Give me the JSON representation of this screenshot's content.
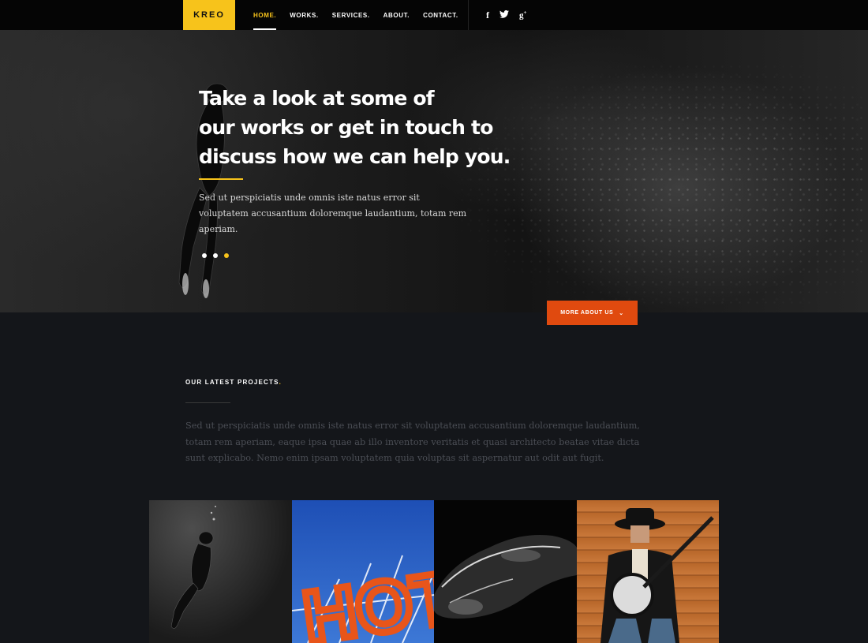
{
  "header": {
    "logo": "KREO",
    "nav": [
      {
        "label": "HOME.",
        "active": true
      },
      {
        "label": "WORKS.",
        "active": false
      },
      {
        "label": "SERVICES.",
        "active": false
      },
      {
        "label": "ABOUT.",
        "active": false
      },
      {
        "label": "CONTACT.",
        "active": false
      }
    ],
    "social": [
      {
        "icon": "facebook-icon",
        "glyph": "f"
      },
      {
        "icon": "twitter-icon",
        "glyph": "🐦"
      },
      {
        "icon": "google-plus-icon",
        "glyph": "g+"
      }
    ]
  },
  "hero": {
    "title_line1": "Take a look at some of",
    "title_line2": "our works or get in touch to",
    "title_line3": "discuss how we can help you.",
    "text": "Sed ut perspiciatis unde omnis iste natus error sit voluptatem accusantium doloremque laudantium, totam rem aperiam.",
    "slides": 3,
    "active_slide": 3,
    "button_label": "MORE ABOUT US",
    "button_icon": "chevron-down-icon"
  },
  "projects": {
    "title": "OUR LATEST PROJECTS",
    "title_dot": ".",
    "text": "Sed ut perspiciatis unde omnis iste natus error sit voluptatem accusantium doloremque laudantium, totam rem aperiam, eaque ipsa quae ab illo inventore veritatis et quasi architecto beatae vitae dicta sunt explicabo. Nemo enim ipsam voluptatem quia voluptas sit aspernatur aut odit aut fugit.",
    "tiles": [
      {
        "name": "diver",
        "sign": ""
      },
      {
        "name": "hotel-sign",
        "sign": "HOT"
      },
      {
        "name": "car",
        "sign": ""
      },
      {
        "name": "banjo-player",
        "sign": ""
      }
    ]
  },
  "colors": {
    "accent": "#f7c31b",
    "button": "#e04a0f",
    "background": "#14161a"
  }
}
